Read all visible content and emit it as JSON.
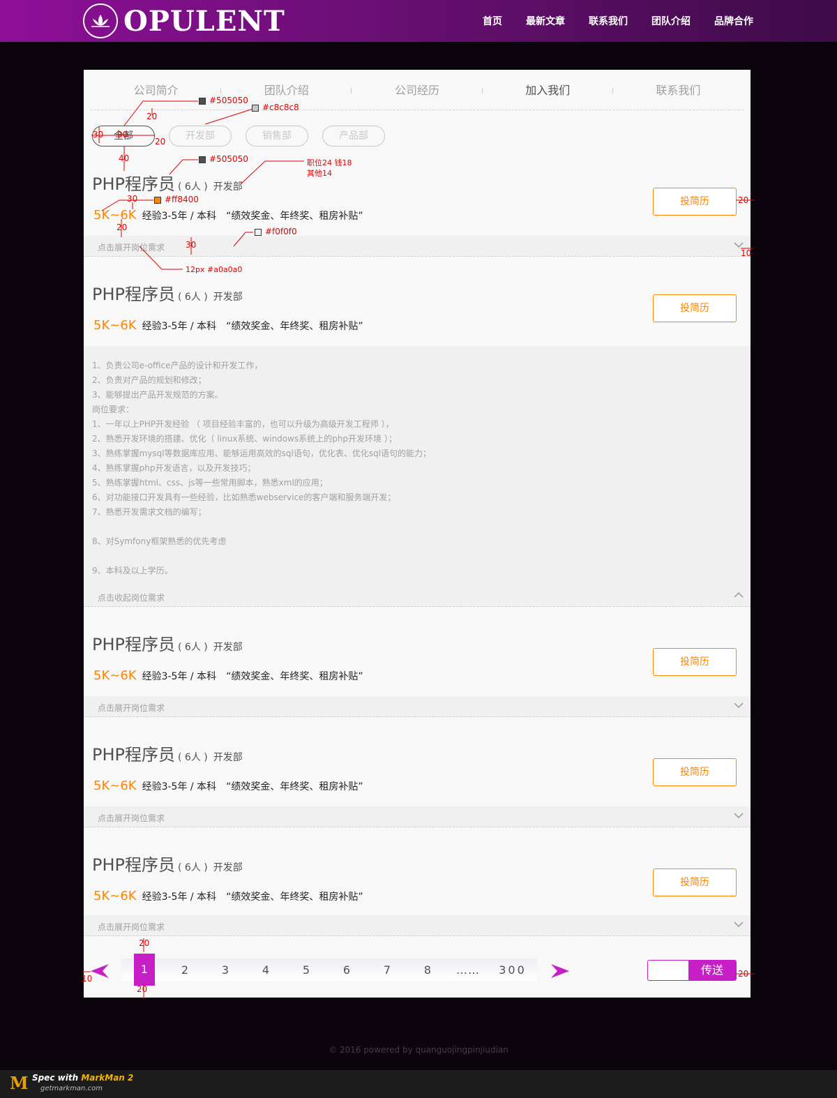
{
  "header": {
    "logo_text": "OPULENT",
    "nav": [
      "首页",
      "最新文章",
      "联系我们",
      "团队介绍",
      "品牌合作"
    ]
  },
  "tabs": [
    {
      "label": "公司简介",
      "active": false
    },
    {
      "label": "团队介绍",
      "active": false
    },
    {
      "label": "公司经历",
      "active": false
    },
    {
      "label": "加入我们",
      "active": true
    },
    {
      "label": "联系我们",
      "active": false
    }
  ],
  "filters": [
    {
      "label": "全部",
      "active": true
    },
    {
      "label": "开发部",
      "active": false
    },
    {
      "label": "销售部",
      "active": false
    },
    {
      "label": "产品部",
      "active": false
    }
  ],
  "jobs": [
    {
      "title": "PHP程序员",
      "count": "( 6人 )",
      "dept": "开发部",
      "salary": "5K~6K",
      "req": "经验3-5年 / 本科",
      "benefit": "“绩效奖金、年终奖、租房补贴”",
      "apply": "投简历",
      "toggle": "点击展开岗位需求"
    },
    {
      "title": "PHP程序员",
      "count": "( 6人 )",
      "dept": "开发部",
      "salary": "5K~6K",
      "req": "经验3-5年 / 本科",
      "benefit": "“绩效奖金、年终奖、租房补贴”",
      "apply": "投简历",
      "toggle": "点击收起岗位需求"
    },
    {
      "title": "PHP程序员",
      "count": "( 6人 )",
      "dept": "开发部",
      "salary": "5K~6K",
      "req": "经验3-5年 / 本科",
      "benefit": "“绩效奖金、年终奖、租房补贴”",
      "apply": "投简历",
      "toggle": "点击展开岗位需求"
    },
    {
      "title": "PHP程序员",
      "count": "( 6人 )",
      "dept": "开发部",
      "salary": "5K~6K",
      "req": "经验3-5年 / 本科",
      "benefit": "“绩效奖金、年终奖、租房补贴”",
      "apply": "投简历",
      "toggle": "点击展开岗位需求"
    },
    {
      "title": "PHP程序员",
      "count": "( 6人 )",
      "dept": "开发部",
      "salary": "5K~6K",
      "req": "经验3-5年 / 本科",
      "benefit": "“绩效奖金、年终奖、租房补贴”",
      "apply": "投简历",
      "toggle": "点击展开岗位需求"
    }
  ],
  "details": [
    "1、负责公司e-office产品的设计和开发工作，",
    "2、负责对产品的规划和修改；",
    "3、能够提出产品开发规范的方案。",
    "岗位要求：",
    "1、一年以上PHP开发经验 （ 项目经验丰富的，也可以升级为高级开发工程师 ），",
    "2、熟悉开发环境的搭建、优化（ linux系统、windows系统上的php开发环境 ）；",
    "3、熟练掌握mysql等数据库应用、能够运用高效的sql语句，优化表、优化sql语句的能力；",
    "4、熟练掌握php开发语言，以及开发技巧；",
    "5、熟练掌握html、css、js等一些常用脚本，熟悉xml的应用；",
    "6、对功能接口开发具有一些经验，比如熟悉webservice的客户端和服务端开发；",
    "7、熟悉开发需求文档的编写；",
    "",
    "8、对Symfony框架熟悉的优先考虑",
    "",
    "9、本科及以上学历。"
  ],
  "pagination": {
    "pages": [
      "1",
      "2",
      "3",
      "4",
      "5",
      "6",
      "7",
      "8",
      "……",
      "300"
    ],
    "current": "1",
    "jump_value": "",
    "submit_label": "传送"
  },
  "footer": {
    "text": "© 2016 powered by quanguojingpinjiudian"
  },
  "markman": {
    "line1_prefix": "Spec with",
    "line1_brand": "MarkMan 2",
    "line2": "getmarkman.com"
  },
  "annotations": {
    "c1": "#505050",
    "c2": "#c8c8c8",
    "c3": "#505050",
    "c4": "#ff8400",
    "c5": "#f0f0f0",
    "font_note_1": "职位24  钱18",
    "font_note_2": "其他14",
    "small_note": "12px  #a0a0a0",
    "d20a": "20",
    "d30a": "30",
    "d90": "90",
    "d20b": "20",
    "d40": "40",
    "d30b": "30",
    "d20c": "20",
    "d30c": "30",
    "d20d": "20",
    "d10a": "10",
    "d20e": "20",
    "d20f": "20",
    "d10b": "10",
    "d20g": "20"
  },
  "colors": {
    "accent": "#c71ec7",
    "salary": "#ff8400",
    "text": "#505050",
    "muted": "#a0a0a0"
  }
}
